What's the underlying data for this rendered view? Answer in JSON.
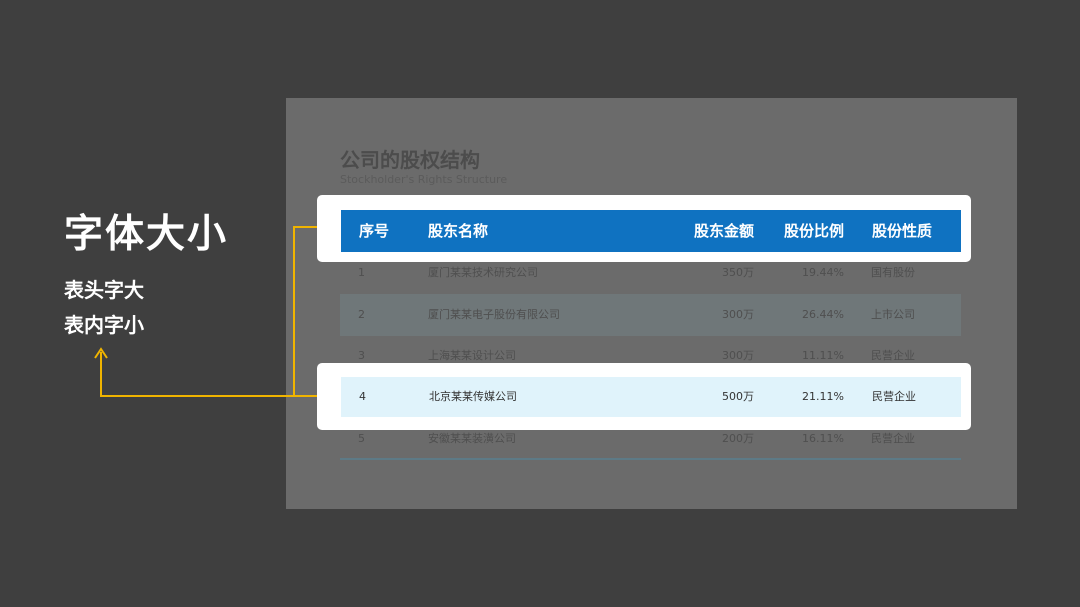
{
  "left": {
    "title": "字体大小",
    "line1": "表头字大",
    "line2": "表内字小"
  },
  "slide": {
    "title": "公司的股权结构",
    "subtitle": "Stockholder's Rights Structure"
  },
  "table": {
    "headers": [
      "序号",
      "股东名称",
      "股东金额",
      "股份比例",
      "股份性质"
    ],
    "rows": [
      [
        "1",
        "厦门某某技术研究公司",
        "350万",
        "19.44%",
        "国有股份"
      ],
      [
        "2",
        "厦门某某电子股份有限公司",
        "300万",
        "26.44%",
        "上市公司"
      ],
      [
        "3",
        "上海某某设计公司",
        "300万",
        "11.11%",
        "民营企业"
      ],
      [
        "4",
        "北京某某传媒公司",
        "500万",
        "21.11%",
        "民营企业"
      ],
      [
        "5",
        "安徽某某装潢公司",
        "200万",
        "16.11%",
        "民营企业"
      ]
    ]
  },
  "colors": {
    "background": "#3f3f3f",
    "header": "#0f72c1",
    "highlight_row": "#e0f3fb",
    "connector": "#f0b400"
  }
}
